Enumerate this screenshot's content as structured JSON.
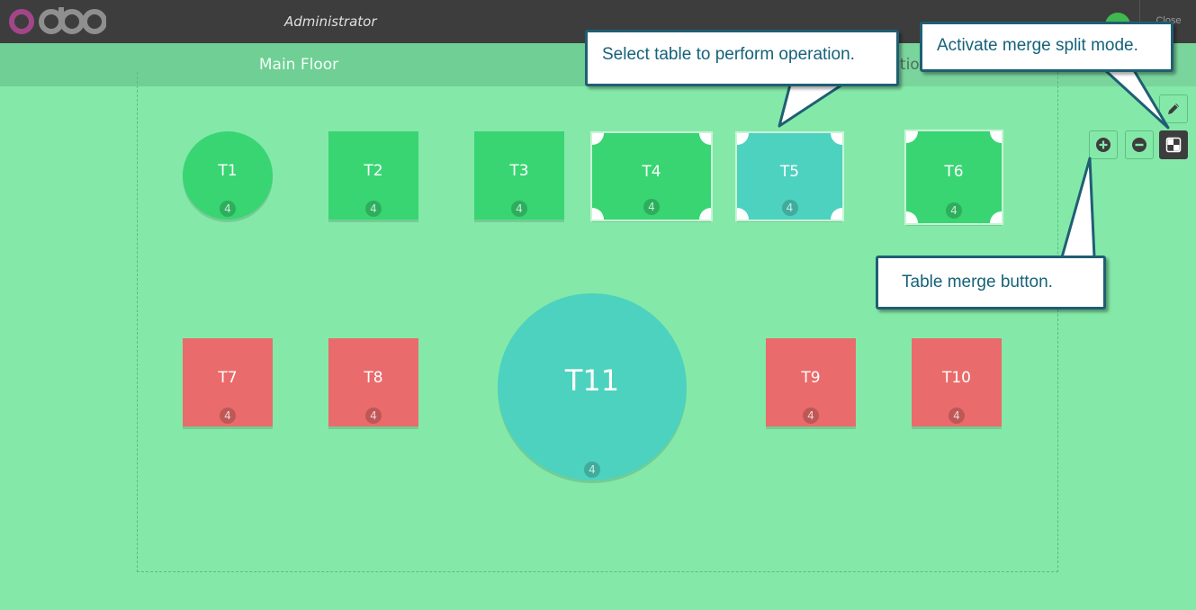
{
  "topbar": {
    "user_name": "Administrator",
    "close_label": "Close"
  },
  "floors": [
    {
      "label": "Main Floor"
    },
    {
      "label": "Patio"
    }
  ],
  "tables": [
    {
      "name": "T1",
      "seats": "4",
      "shape": "round",
      "status": "available"
    },
    {
      "name": "T2",
      "seats": "4",
      "shape": "square",
      "status": "available"
    },
    {
      "name": "T3",
      "seats": "4",
      "shape": "square",
      "status": "available"
    },
    {
      "name": "T4",
      "seats": "4",
      "shape": "square",
      "status": "merge-selectable"
    },
    {
      "name": "T5",
      "seats": "4",
      "shape": "square",
      "status": "selected"
    },
    {
      "name": "T6",
      "seats": "4",
      "shape": "square",
      "status": "merge-selectable"
    },
    {
      "name": "T7",
      "seats": "4",
      "shape": "square",
      "status": "occupied"
    },
    {
      "name": "T8",
      "seats": "4",
      "shape": "square",
      "status": "occupied"
    },
    {
      "name": "T11",
      "seats": "4",
      "shape": "round",
      "status": "selected"
    },
    {
      "name": "T9",
      "seats": "4",
      "shape": "square",
      "status": "occupied"
    },
    {
      "name": "T10",
      "seats": "4",
      "shape": "square",
      "status": "occupied"
    }
  ],
  "controls": {
    "edit_icon": "pencil-icon",
    "add_icon": "plus-circle-icon",
    "remove_icon": "minus-circle-icon",
    "merge_split_icon": "merge-split-icon"
  },
  "callouts": {
    "select_table": "Select table to perform operation.",
    "merge_split_mode": "Activate merge split mode.",
    "merge_button": "Table merge button."
  },
  "colors": {
    "available": "#38d572",
    "occupied": "#ea6b6b",
    "selected": "#4dd2bf",
    "floor_background": "#84e9a8",
    "topbar": "#3d3d3d"
  }
}
